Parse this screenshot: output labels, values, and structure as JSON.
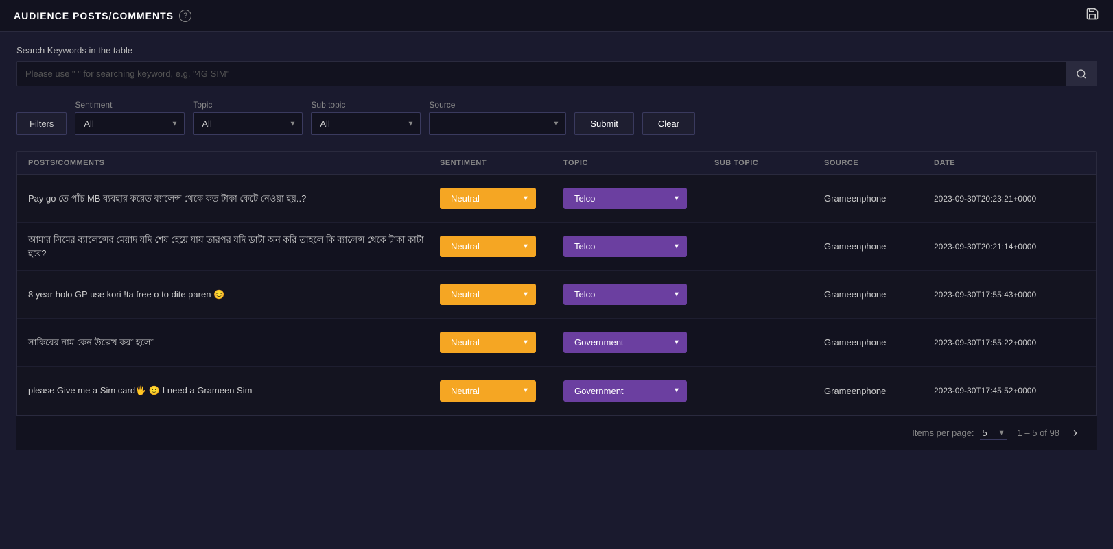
{
  "topbar": {
    "title": "AUDIENCE POSTS/COMMENTS",
    "help_icon": "?",
    "save_icon": "🖫"
  },
  "search": {
    "label": "Search Keywords in the table",
    "placeholder": "Please use \" \" for searching keyword, e.g. \"4G SIM\"",
    "value": ""
  },
  "filters": {
    "filters_btn_label": "Filters",
    "sentiment_label": "Sentiment",
    "sentiment_options": [
      "All"
    ],
    "sentiment_value": "All",
    "topic_label": "Topic",
    "topic_options": [
      "All"
    ],
    "topic_value": "All",
    "subtopic_label": "Sub topic",
    "subtopic_options": [
      "All"
    ],
    "subtopic_value": "All",
    "source_label": "Source",
    "source_options": [
      ""
    ],
    "source_value": "",
    "submit_label": "Submit",
    "clear_label": "Clear"
  },
  "table": {
    "headers": [
      "POSTS/COMMENTS",
      "SENTIMENT",
      "TOPIC",
      "SUB TOPIC",
      "SOURCE",
      "DATE"
    ],
    "rows": [
      {
        "post": "Pay go তে পাঁচ MB ব্যবহার করেত ব্যালেন্স থেকে কত টাকা কেটে নেওয়া হয়..?",
        "sentiment": "Neutral",
        "topic": "Telco",
        "subtopic": "",
        "source": "Grameenphone",
        "date": "2023-09-30T20:23:21+0000"
      },
      {
        "post": "আমার সিমের ব্যালেন্সের মেয়াদ যদি শেষ হেয়ে যায় তারপর যদি ডাটা অন করি তাহলে কি ব্যালেন্স থেকে টাকা কাটা হবে?",
        "sentiment": "Neutral",
        "topic": "Telco",
        "subtopic": "",
        "source": "Grameenphone",
        "date": "2023-09-30T20:21:14+0000"
      },
      {
        "post": "8 year holo GP use kori !ta free o to dite paren 😊",
        "sentiment": "Neutral",
        "topic": "Telco",
        "subtopic": "",
        "source": "Grameenphone",
        "date": "2023-09-30T17:55:43+0000"
      },
      {
        "post": "সাকিবের নাম কেন উল্লেখ করা হলো",
        "sentiment": "Neutral",
        "topic": "Government",
        "subtopic": "",
        "source": "Grameenphone",
        "date": "2023-09-30T17:55:22+0000"
      },
      {
        "post": "please Give me a Sim card🖐 🙂 I need a Grameen Sim",
        "sentiment": "Neutral",
        "topic": "Government",
        "subtopic": "",
        "source": "Grameenphone",
        "date": "2023-09-30T17:45:52+0000"
      }
    ]
  },
  "pagination": {
    "items_per_page_label": "Items per page:",
    "items_per_page_value": "5",
    "page_range": "1 – 5 of 98",
    "next_btn": "›"
  }
}
